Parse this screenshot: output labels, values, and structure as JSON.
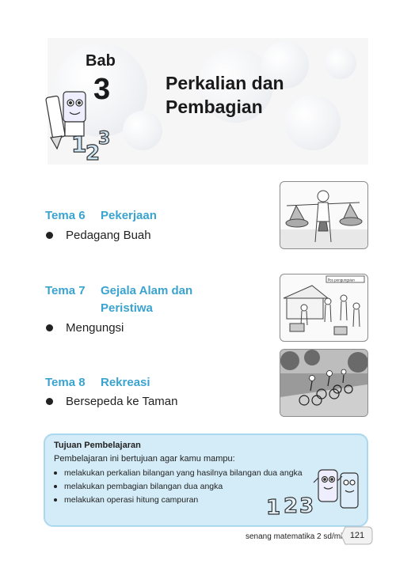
{
  "chapter": {
    "bab_word": "Bab",
    "number": "3",
    "title_line1": "Perkalian dan",
    "title_line2": "Pembagian"
  },
  "themes": [
    {
      "label": "Tema 6",
      "title_line1": "Pekerjaan",
      "title_line2": "",
      "item": "Pedagang Buah"
    },
    {
      "label": "Tema 7",
      "title_line1": "Gejala Alam dan",
      "title_line2": "Peristiwa",
      "item": "Mengungsi"
    },
    {
      "label": "Tema 8",
      "title_line1": "Rekreasi",
      "title_line2": "",
      "item": "Bersepeda ke Taman"
    }
  ],
  "illustrations": {
    "evac_sign": "Pos pengungsian"
  },
  "tujuan": {
    "title": "Tujuan Pembelajaran",
    "intro": "Pembelajaran ini bertujuan agar kamu mampu:",
    "items": [
      "melakukan perkalian bilangan yang hasilnya bilangan dua angka",
      "melakukan pembagian bilangan dua angka",
      "melakukan operasi hitung campuran"
    ],
    "mascot_digits": [
      "1",
      "2",
      "3"
    ]
  },
  "footer": {
    "book_title": "senang matematika 2 sd/mi",
    "page_number": "121"
  }
}
